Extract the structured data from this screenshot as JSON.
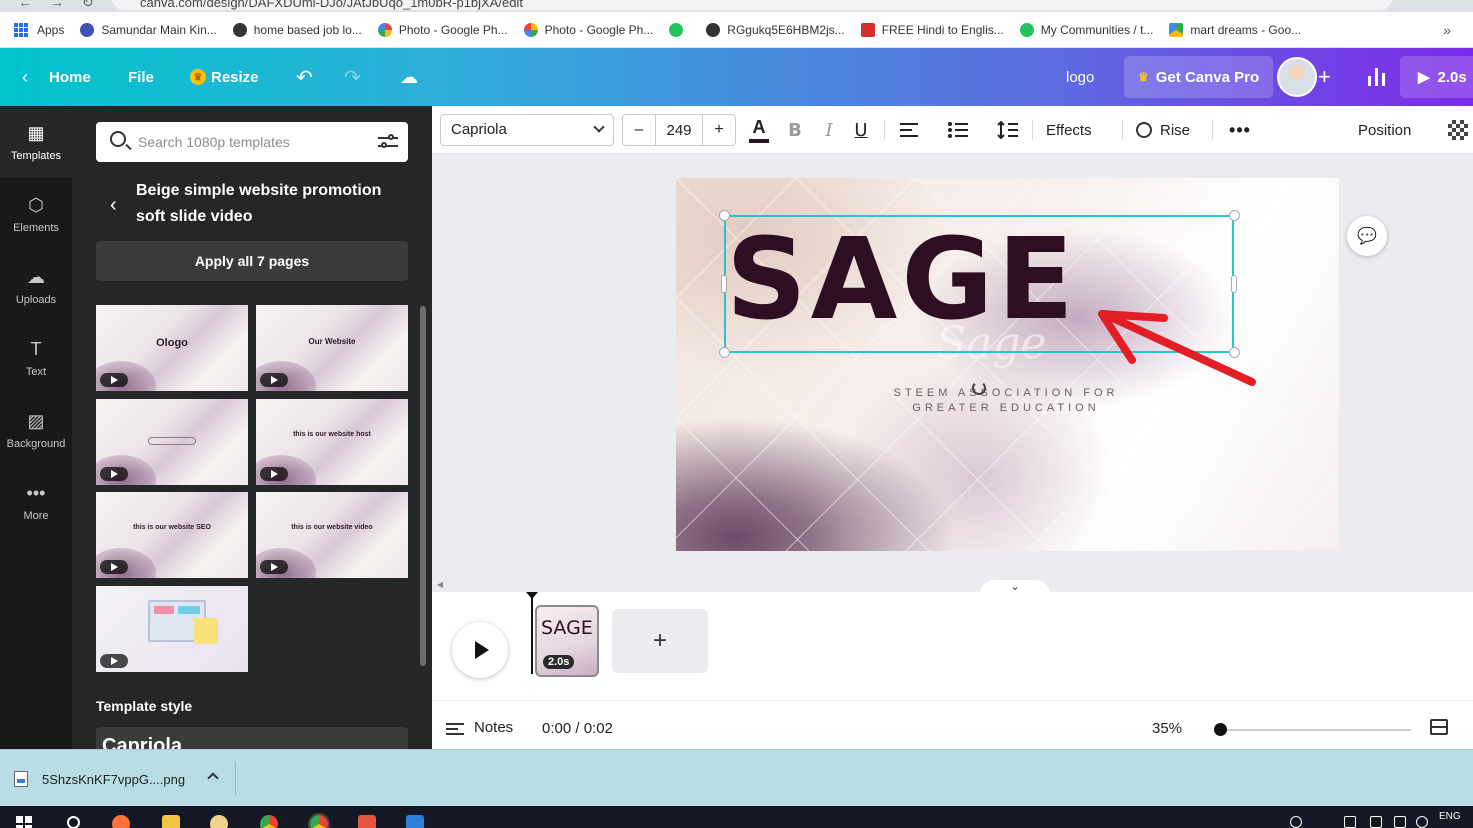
{
  "browser": {
    "url": "canva.com/design/DAFXDUmi-DJo/JAtJbUqo_1m0bR-p1bjXA/edit",
    "bookmarks": [
      {
        "label": "Apps",
        "icon": "apps-grid-icon",
        "color": "#1a73e8"
      },
      {
        "label": "Samundar Main Kin...",
        "icon": "h-site-icon",
        "color": "#3f51b5"
      },
      {
        "label": "home based job lo...",
        "icon": "globe-icon",
        "color": "#333333"
      },
      {
        "label": "Photo - Google Ph...",
        "icon": "google-photos-icon",
        "color": "#ea4335"
      },
      {
        "label": "Photo - Google Ph...",
        "icon": "google-photos-icon",
        "color": "#fbbc05"
      },
      {
        "label": "",
        "icon": "green-circle-icon",
        "color": "#21c35a"
      },
      {
        "label": "RGgukq5E6HBM2js...",
        "icon": "globe-icon",
        "color": "#333333"
      },
      {
        "label": "FREE Hindi to Englis...",
        "icon": "hindi-site-icon",
        "color": "#d32f2f"
      },
      {
        "label": "My Communities / t...",
        "icon": "green-circle-icon",
        "color": "#21c35a"
      },
      {
        "label": "mart dreams - Goo...",
        "icon": "google-drive-icon",
        "color": "#34a853"
      }
    ]
  },
  "header": {
    "home": "Home",
    "file": "File",
    "resize": "Resize",
    "title": "logo",
    "pro": "Get Canva Pro",
    "present": "2.0s"
  },
  "rail": [
    {
      "label": "Templates",
      "icon": "templates-icon",
      "glyph": "▦",
      "active": true
    },
    {
      "label": "Elements",
      "icon": "elements-icon",
      "glyph": "⬡",
      "active": false
    },
    {
      "label": "Uploads",
      "icon": "upload-cloud-icon",
      "glyph": "☁",
      "active": false
    },
    {
      "label": "Text",
      "icon": "text-icon",
      "glyph": "T",
      "active": false
    },
    {
      "label": "Background",
      "icon": "background-icon",
      "glyph": "▨",
      "active": false
    },
    {
      "label": "More",
      "icon": "more-dots-icon",
      "glyph": "•••",
      "active": false
    }
  ],
  "panel": {
    "search_placeholder": "Search 1080p templates",
    "template_title": "Beige simple website promotion soft slide video",
    "apply": "Apply all 7 pages",
    "thumbnails": [
      "Ologo",
      "Our Website",
      "",
      "this is our website host",
      "this is our website SEO",
      "this is our website video",
      ""
    ],
    "style_heading": "Template style",
    "style_font": "Capriola"
  },
  "toolbar": {
    "font": "Capriola",
    "size": "249",
    "minus": "–",
    "plus": "+",
    "color_glyph": "A",
    "bold": "B",
    "italic": "I",
    "underline": "U",
    "effects": "Effects",
    "animate": "Rise",
    "more": "•••",
    "position": "Position",
    "text_color": "#2d0e22"
  },
  "canvas": {
    "headline": "SAGE",
    "subline": "STEEM ASSOCIATION FOR GREATER EDUCATION",
    "annotation_color": "#e31e25",
    "selection_color": "#28c2d1"
  },
  "timeline": {
    "clip_label": "SAGE",
    "clip_duration": "2.0s",
    "add": "+"
  },
  "footer": {
    "notes": "Notes",
    "time": "0:00 / 0:02",
    "zoom": "35%",
    "zoom_level_percent": 35
  },
  "download": {
    "file": "5ShzsKnKF7vppG....png"
  },
  "taskbar": {
    "lang": "ENG"
  }
}
